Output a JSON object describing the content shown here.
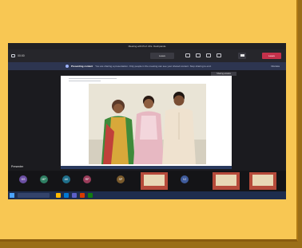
{
  "window": {
    "title": "Meeting with Prof. Mrs. Deshpande"
  },
  "toolbar": {
    "left_label": "00:00",
    "record_label": "Leave",
    "leave_label": "Leave"
  },
  "banner": {
    "title": "Presenting content",
    "text": "You are sharing a presentation. Only people in the meeting can see your shared content. Stop sharing to end.",
    "dismiss": "Dismiss"
  },
  "share_label": "Sharing window",
  "presenter_name": "Presenter",
  "tiles": [
    {
      "initials": "DS",
      "name": "",
      "color": "#6b4fa3"
    },
    {
      "initials": "MP",
      "name": "",
      "color": "#2f7f63"
    },
    {
      "initials": "AK",
      "name": "",
      "color": "#1f6f8b"
    },
    {
      "initials": "RP",
      "name": "",
      "color": "#9a3c5a"
    },
    {
      "initials": "SP",
      "name": "",
      "color": "#7a5a2c"
    },
    {
      "initials": "VJ",
      "name": "",
      "color": "#3f5b9c"
    }
  ],
  "taskbar": {
    "clock": ""
  },
  "colors": {
    "frame": "#f8c753",
    "leave": "#c4314b",
    "app_bg": "#1b1b1f"
  }
}
